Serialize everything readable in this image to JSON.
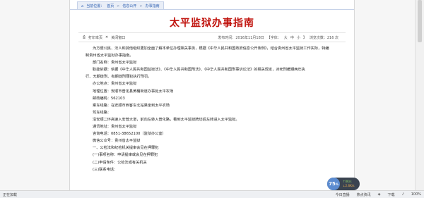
{
  "breadcrumb": {
    "label": "当前位置：",
    "items": [
      "首页",
      "信息公开",
      "办事指南"
    ],
    "separator": ">"
  },
  "title": "太平监狱办事指南",
  "toolbar": {
    "print": "打印本页",
    "close": "关闭窗口",
    "date": "发布时间：2016年11月18日",
    "font_prefix": "【字体：",
    "font_large": "大",
    "font_mid": "中",
    "font_small": "小",
    "font_suffix": "】",
    "views": "浏览次数：216 次"
  },
  "content": [
    {
      "text": "为方便公民、法人和其他组织更加全面了解本单位办理相关事务，根据《中华人民共和国政府信息公开条例》，结合贵州省太平监狱工作实际，特编",
      "indent": true
    },
    {
      "text": "制贵州省太平监狱办事指南。",
      "indent": false
    },
    {
      "text": "部门名称：贵州省太平监狱",
      "indent": true
    },
    {
      "text": "职能依据：依据《中华人民共和国监狱法》、《中华人民共和国刑法》、《中华人民共和国刑事诉讼法》的相关规定，对死刑缓期两年执",
      "indent": true
    },
    {
      "text": "行、无期徒刑、有期徒刑罪犯执行刑罚。",
      "indent": false
    },
    {
      "text": "办公地点：贵州省太平监狱",
      "indent": true
    },
    {
      "text": "地理位置：安顺市普定县黄桶街道办事处太平农场",
      "indent": true
    },
    {
      "text": "邮政编码：562103",
      "indent": true
    },
    {
      "text": "乘车线路：在安顺市西客车北站乘坐到太平农场",
      "indent": true
    },
    {
      "text": "驾车线路：",
      "indent": true
    },
    {
      "text": "沿安顺二环高速入安普大道，前向左转入普化路，看到太平监狱牌坊后左转进入太平监狱。",
      "indent": true
    },
    {
      "text": "通讯地址：贵州省太平监狱",
      "indent": true
    },
    {
      "text": "咨询电话：0851-38652100（监狱办公室）",
      "indent": true
    },
    {
      "text": "微信公众号：贵州省太平监狱",
      "indent": true
    },
    {
      "text": "一、公检法和纪检机关提审会见在押罪犯",
      "indent": true
    },
    {
      "text": "(一)事项名称：申请提审或会见在押罪犯",
      "indent": true
    },
    {
      "text": "(二)申请条件：公检法或有关机关",
      "indent": true
    },
    {
      "text": "(三)联系电话：",
      "indent": true
    }
  ],
  "statusbar": {
    "left": "正在加载",
    "items": [
      "今日直播",
      "热点资讯",
      "",
      "下载",
      "",
      "100%"
    ]
  },
  "widget": {
    "percent": "75",
    "percent_unit": "%",
    "up": "0K/s",
    "down": "2.6K/s"
  }
}
